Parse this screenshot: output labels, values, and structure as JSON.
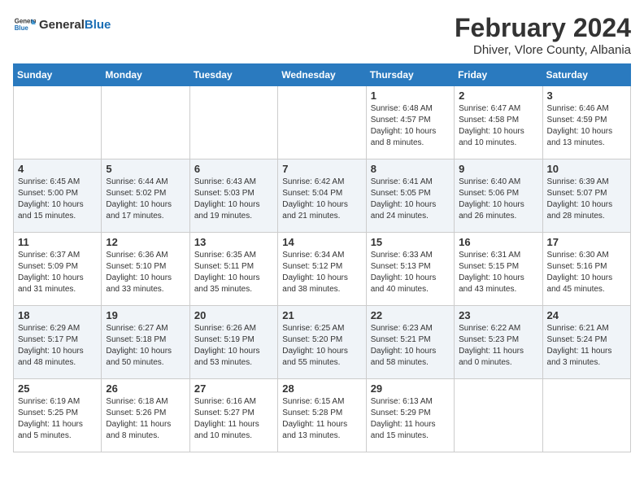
{
  "header": {
    "logo_general": "General",
    "logo_blue": "Blue",
    "title": "February 2024",
    "subtitle": "Dhiver, Vlore County, Albania"
  },
  "days": [
    "Sunday",
    "Monday",
    "Tuesday",
    "Wednesday",
    "Thursday",
    "Friday",
    "Saturday"
  ],
  "weeks": [
    [
      {
        "date": "",
        "info": ""
      },
      {
        "date": "",
        "info": ""
      },
      {
        "date": "",
        "info": ""
      },
      {
        "date": "",
        "info": ""
      },
      {
        "date": "1",
        "info": "Sunrise: 6:48 AM\nSunset: 4:57 PM\nDaylight: 10 hours\nand 8 minutes."
      },
      {
        "date": "2",
        "info": "Sunrise: 6:47 AM\nSunset: 4:58 PM\nDaylight: 10 hours\nand 10 minutes."
      },
      {
        "date": "3",
        "info": "Sunrise: 6:46 AM\nSunset: 4:59 PM\nDaylight: 10 hours\nand 13 minutes."
      }
    ],
    [
      {
        "date": "4",
        "info": "Sunrise: 6:45 AM\nSunset: 5:00 PM\nDaylight: 10 hours\nand 15 minutes."
      },
      {
        "date": "5",
        "info": "Sunrise: 6:44 AM\nSunset: 5:02 PM\nDaylight: 10 hours\nand 17 minutes."
      },
      {
        "date": "6",
        "info": "Sunrise: 6:43 AM\nSunset: 5:03 PM\nDaylight: 10 hours\nand 19 minutes."
      },
      {
        "date": "7",
        "info": "Sunrise: 6:42 AM\nSunset: 5:04 PM\nDaylight: 10 hours\nand 21 minutes."
      },
      {
        "date": "8",
        "info": "Sunrise: 6:41 AM\nSunset: 5:05 PM\nDaylight: 10 hours\nand 24 minutes."
      },
      {
        "date": "9",
        "info": "Sunrise: 6:40 AM\nSunset: 5:06 PM\nDaylight: 10 hours\nand 26 minutes."
      },
      {
        "date": "10",
        "info": "Sunrise: 6:39 AM\nSunset: 5:07 PM\nDaylight: 10 hours\nand 28 minutes."
      }
    ],
    [
      {
        "date": "11",
        "info": "Sunrise: 6:37 AM\nSunset: 5:09 PM\nDaylight: 10 hours\nand 31 minutes."
      },
      {
        "date": "12",
        "info": "Sunrise: 6:36 AM\nSunset: 5:10 PM\nDaylight: 10 hours\nand 33 minutes."
      },
      {
        "date": "13",
        "info": "Sunrise: 6:35 AM\nSunset: 5:11 PM\nDaylight: 10 hours\nand 35 minutes."
      },
      {
        "date": "14",
        "info": "Sunrise: 6:34 AM\nSunset: 5:12 PM\nDaylight: 10 hours\nand 38 minutes."
      },
      {
        "date": "15",
        "info": "Sunrise: 6:33 AM\nSunset: 5:13 PM\nDaylight: 10 hours\nand 40 minutes."
      },
      {
        "date": "16",
        "info": "Sunrise: 6:31 AM\nSunset: 5:15 PM\nDaylight: 10 hours\nand 43 minutes."
      },
      {
        "date": "17",
        "info": "Sunrise: 6:30 AM\nSunset: 5:16 PM\nDaylight: 10 hours\nand 45 minutes."
      }
    ],
    [
      {
        "date": "18",
        "info": "Sunrise: 6:29 AM\nSunset: 5:17 PM\nDaylight: 10 hours\nand 48 minutes."
      },
      {
        "date": "19",
        "info": "Sunrise: 6:27 AM\nSunset: 5:18 PM\nDaylight: 10 hours\nand 50 minutes."
      },
      {
        "date": "20",
        "info": "Sunrise: 6:26 AM\nSunset: 5:19 PM\nDaylight: 10 hours\nand 53 minutes."
      },
      {
        "date": "21",
        "info": "Sunrise: 6:25 AM\nSunset: 5:20 PM\nDaylight: 10 hours\nand 55 minutes."
      },
      {
        "date": "22",
        "info": "Sunrise: 6:23 AM\nSunset: 5:21 PM\nDaylight: 10 hours\nand 58 minutes."
      },
      {
        "date": "23",
        "info": "Sunrise: 6:22 AM\nSunset: 5:23 PM\nDaylight: 11 hours\nand 0 minutes."
      },
      {
        "date": "24",
        "info": "Sunrise: 6:21 AM\nSunset: 5:24 PM\nDaylight: 11 hours\nand 3 minutes."
      }
    ],
    [
      {
        "date": "25",
        "info": "Sunrise: 6:19 AM\nSunset: 5:25 PM\nDaylight: 11 hours\nand 5 minutes."
      },
      {
        "date": "26",
        "info": "Sunrise: 6:18 AM\nSunset: 5:26 PM\nDaylight: 11 hours\nand 8 minutes."
      },
      {
        "date": "27",
        "info": "Sunrise: 6:16 AM\nSunset: 5:27 PM\nDaylight: 11 hours\nand 10 minutes."
      },
      {
        "date": "28",
        "info": "Sunrise: 6:15 AM\nSunset: 5:28 PM\nDaylight: 11 hours\nand 13 minutes."
      },
      {
        "date": "29",
        "info": "Sunrise: 6:13 AM\nSunset: 5:29 PM\nDaylight: 11 hours\nand 15 minutes."
      },
      {
        "date": "",
        "info": ""
      },
      {
        "date": "",
        "info": ""
      }
    ]
  ]
}
